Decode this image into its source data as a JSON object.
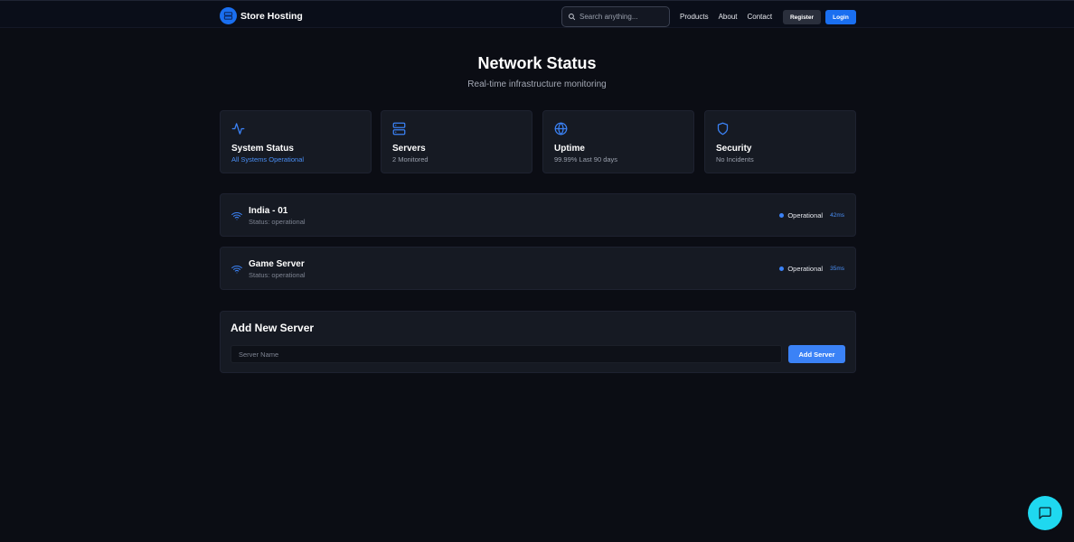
{
  "brand": {
    "name": "Store Hosting",
    "logo_icon": "server-stack-icon",
    "logo_color": "#1a6ff0"
  },
  "search": {
    "placeholder": "Search anything...",
    "value": ""
  },
  "nav": {
    "links": [
      "Products",
      "About",
      "Contact"
    ],
    "register_label": "Register",
    "login_label": "Login"
  },
  "hero": {
    "title": "Network Status",
    "subtitle": "Real-time infrastructure monitoring"
  },
  "stats": [
    {
      "icon": "activity-icon",
      "title": "System Status",
      "subtitle": "All Systems Operational",
      "accent": true
    },
    {
      "icon": "server-icon",
      "title": "Servers",
      "subtitle": "2 Monitored",
      "accent": false
    },
    {
      "icon": "globe-icon",
      "title": "Uptime",
      "subtitle": "99.99% Last 90 days",
      "accent": false
    },
    {
      "icon": "shield-icon",
      "title": "Security",
      "subtitle": "No Incidents",
      "accent": false
    }
  ],
  "servers": [
    {
      "name": "India - 01",
      "status": "Status: operational",
      "badge": "Operational",
      "latency": "42ms"
    },
    {
      "name": "Game Server",
      "status": "Status: operational",
      "badge": "Operational",
      "latency": "35ms"
    }
  ],
  "add_server": {
    "title": "Add New Server",
    "input_placeholder": "Server Name",
    "input_value": "",
    "button_label": "Add Server"
  },
  "chat": {
    "icon": "chat-bubble-icon",
    "color": "#1fd8f0"
  },
  "colors": {
    "accent": "#3b82f6",
    "brand": "#1a6ff0",
    "background": "#0b0d14",
    "card": "#161a23"
  }
}
